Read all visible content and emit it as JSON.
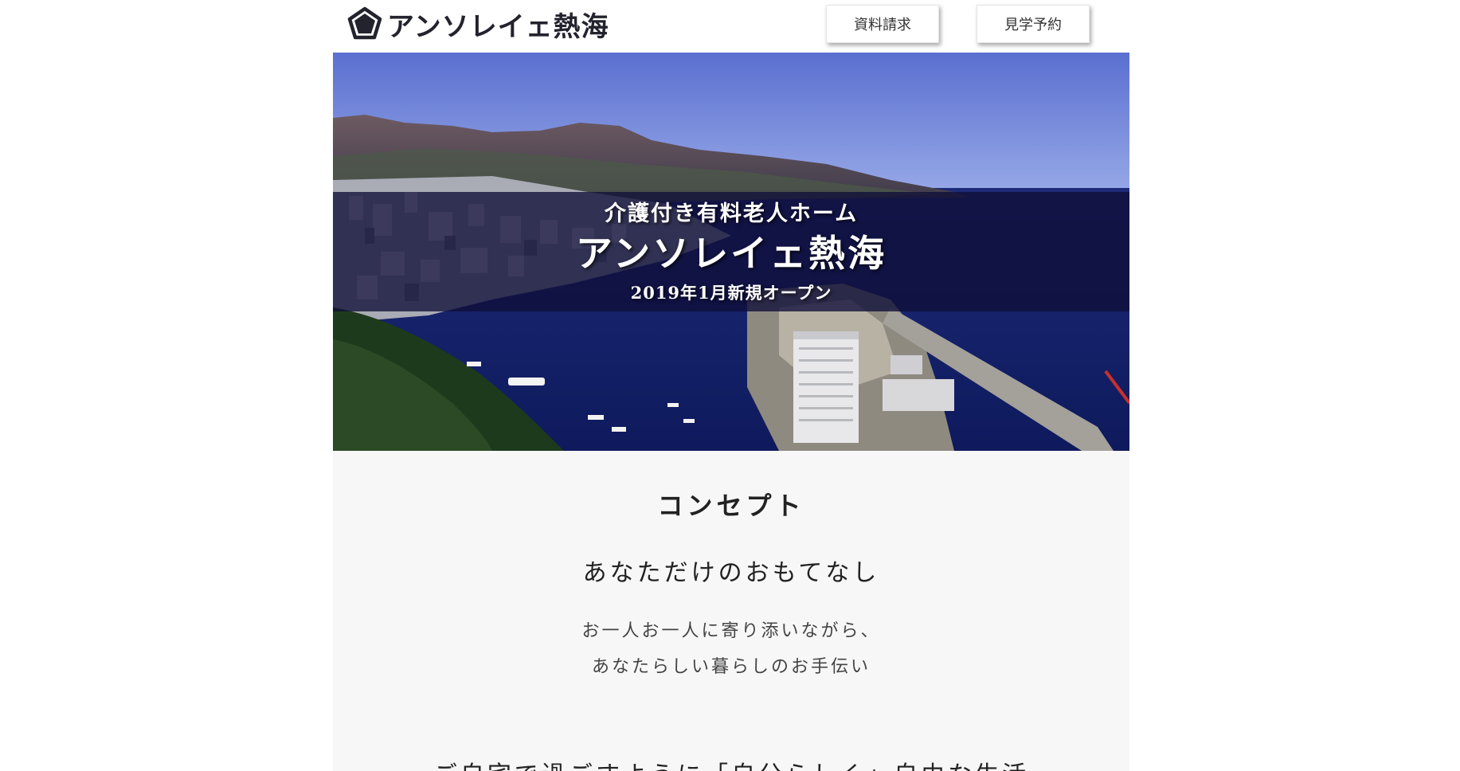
{
  "header": {
    "logo_text": "アンソレイェ熱海",
    "logo_icon": "pentagon-logo-icon",
    "buttons": {
      "brochure": "資料請求",
      "visit": "見学予約"
    }
  },
  "hero": {
    "image": "aerial photo of Atami bay, town and harbor",
    "subtitle": "介護付き有料老人ホーム",
    "title": "アンソレイェ熱海",
    "opening": "2019年1月新規オープン"
  },
  "concept": {
    "heading": "コンセプト",
    "catchphrase": "あなただけのおもてなし",
    "body": [
      "お一人お一人に寄り添いながら、",
      "あなたらしい暮らしのお手伝い"
    ],
    "next_heading": "ご自宅で過ごすように「自分らしく」自由な生活"
  },
  "colors": {
    "logo": "#23232e",
    "hero_band": "#100e38",
    "concept_bg": "#f7f7f7",
    "text": "#222222"
  }
}
